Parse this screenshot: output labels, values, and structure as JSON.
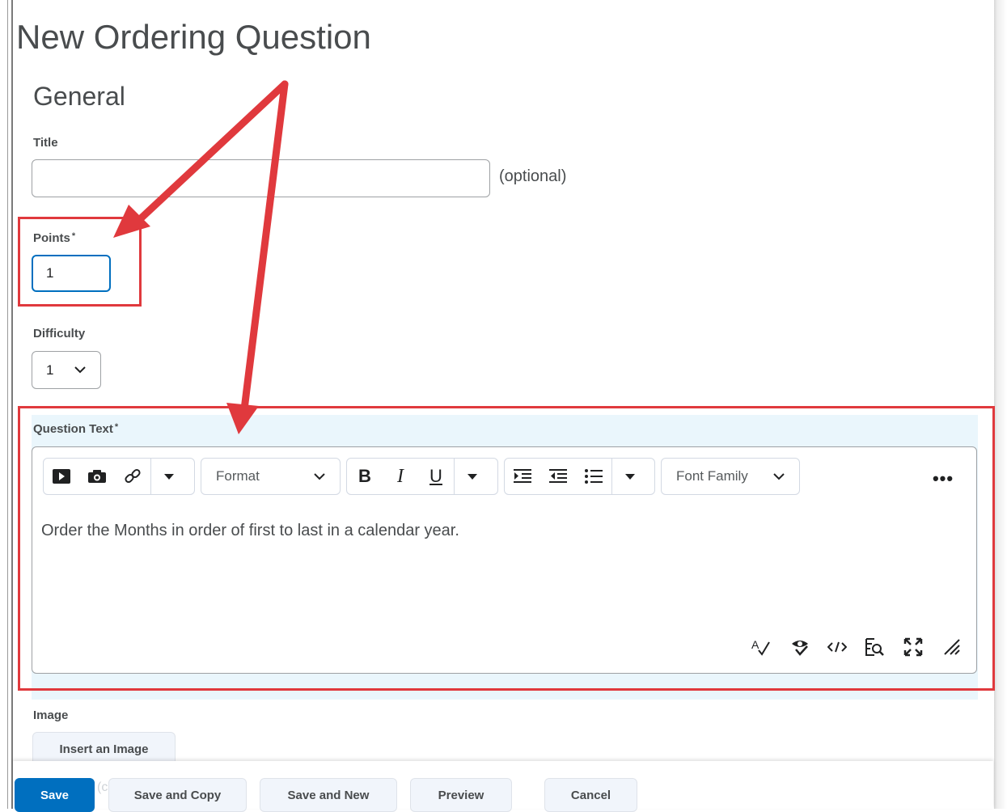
{
  "page": {
    "title": "New Ordering Question"
  },
  "general": {
    "section_title": "General",
    "title_field": {
      "label": "Title",
      "value": "",
      "hint": "(optional)"
    },
    "points_field": {
      "label": "Points",
      "required_mark": "*",
      "value": "1"
    },
    "difficulty_field": {
      "label": "Difficulty",
      "value": "1"
    }
  },
  "question_text": {
    "label": "Question Text",
    "required_mark": "*",
    "toolbar": {
      "insert_group": [
        "insert-video-icon",
        "insert-image-icon",
        "insert-link-icon",
        "more-insert-caret-icon"
      ],
      "format_select": "Format",
      "style_group": {
        "bold": "B",
        "italic": "I",
        "underline": "U"
      },
      "list_group": [
        "indent-icon",
        "outdent-icon",
        "bulleted-list-icon",
        "more-list-caret-icon"
      ],
      "font_family_select": "Font Family",
      "more": "•••"
    },
    "content": "Order the Months in order of first to last in a calendar year.",
    "status_bar_icons": [
      "spellcheck-icon",
      "accessibility-checker-icon",
      "source-code-icon",
      "preview-icon",
      "fullscreen-icon",
      "resize-handle-icon"
    ]
  },
  "image": {
    "label": "Image",
    "insert_button": "Insert an Image"
  },
  "footer": {
    "ghost_text": "(c",
    "buttons": {
      "save": "Save",
      "save_and_copy": "Save and Copy",
      "save_and_new": "Save and New",
      "preview": "Preview",
      "cancel": "Cancel"
    }
  },
  "colors": {
    "primary": "#006fbf",
    "annotation": "#e0393d",
    "editor_band": "#eaf6fc"
  }
}
